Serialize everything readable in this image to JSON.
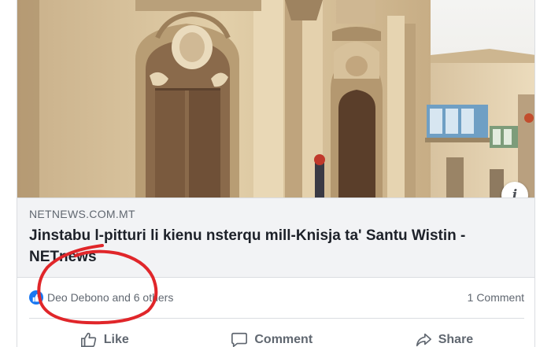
{
  "post": {
    "link_domain": "NETNEWS.COM.MT",
    "link_title": "Jinstabu l-pitturi li kienu nsterqu mill-Knisja ta' Santu Wistin - NETnews",
    "reactions_text": "Deo Debono and 6 others",
    "comments_text": "1 Comment"
  },
  "actions": {
    "like_label": "Like",
    "comment_label": "Comment",
    "share_label": "Share"
  },
  "icons": {
    "info": "info-icon",
    "like_reaction": "thumbs-up-icon",
    "like": "thumbs-up-icon",
    "comment": "speech-bubble-icon",
    "share": "share-arrow-icon"
  },
  "colors": {
    "facebook_blue": "#1877f2",
    "annotation_red": "#e0262a",
    "muted_text": "#606770"
  }
}
